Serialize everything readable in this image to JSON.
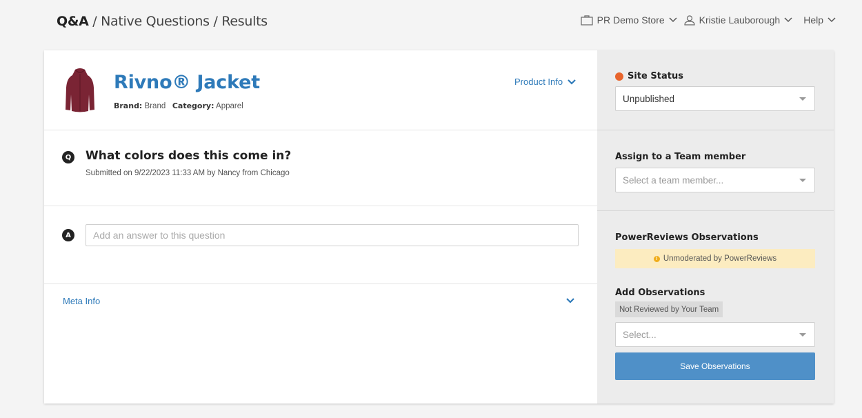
{
  "breadcrumb": {
    "root": "Q&A",
    "sep": " / ",
    "level2": "Native Questions",
    "level3": "Results"
  },
  "topnav": {
    "store": "PR Demo Store",
    "user": "Kristie Lauborough",
    "help": "Help"
  },
  "product": {
    "title": "Rivno® Jacket",
    "brand_label": "Brand:",
    "brand": "Brand",
    "category_label": "Category:",
    "category": "Apparel",
    "info_link": "Product Info",
    "thumbnail_color": "#7a2434"
  },
  "question": {
    "badge": "Q",
    "text": "What colors does this come in?",
    "submitted": "Submitted on 9/22/2023 11:33 AM by Nancy from Chicago"
  },
  "answer": {
    "badge": "A",
    "placeholder": "Add an answer to this question"
  },
  "meta": {
    "label": "Meta Info"
  },
  "sidebar": {
    "site_status": {
      "label": "Site Status",
      "value": "Unpublished",
      "dot_color": "#e8642c"
    },
    "assign": {
      "label": "Assign to a Team member",
      "placeholder": "Select a team member..."
    },
    "observations": {
      "label": "PowerReviews Observations",
      "warning": "Unmoderated by PowerReviews",
      "add_label": "Add Observations",
      "tag": "Not Reviewed by Your Team",
      "select_placeholder": "Select...",
      "save_button": "Save Observations"
    }
  },
  "colors": {
    "accent": "#2e7ab9",
    "button": "#4f90c8",
    "warning_bg": "#fcecc0"
  }
}
